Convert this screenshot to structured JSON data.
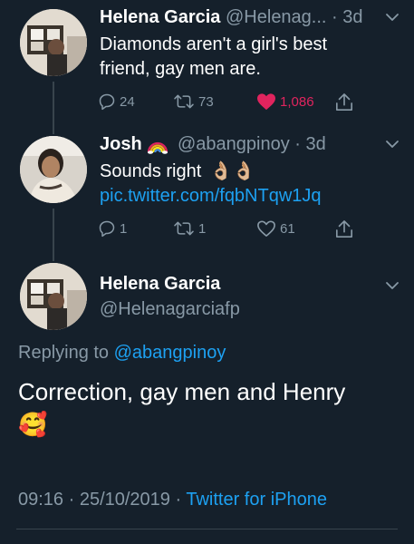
{
  "tweet1": {
    "name": "Helena Garcia",
    "handle_time": "@Helenag... · 3d",
    "text_line1": "Diamonds aren't a girl's best",
    "text_line2": "friend, gay men are.",
    "replies": "24",
    "retweets": "73",
    "likes": "1,086",
    "like_color": "#e0245e"
  },
  "tweet2": {
    "name": "Josh",
    "handle_time": "@abangpinoy · 3d",
    "text": "Sounds right",
    "emoji": "👌🏼👌🏼",
    "link": "pic.twitter.com/fqbNTqw1Jq",
    "replies": "1",
    "retweets": "1",
    "likes": "61"
  },
  "main_tweet": {
    "name": "Helena Garcia",
    "handle": "@Helenagarciafp",
    "replying_prefix": "Replying to",
    "replying_handle": "@abangpinoy",
    "text": "Correction, gay men and Henry",
    "emoji": "🥰",
    "timestamp": "09:16 · 25/10/2019 ·",
    "source": "Twitter for iPhone"
  },
  "colors": {
    "background": "#15202b",
    "secondary_text": "#8899a6",
    "link": "#1da1f2"
  },
  "icons": [
    "reply-icon",
    "retweet-icon",
    "heart-icon",
    "share-icon",
    "chevron-down-icon",
    "rainbow-icon"
  ]
}
